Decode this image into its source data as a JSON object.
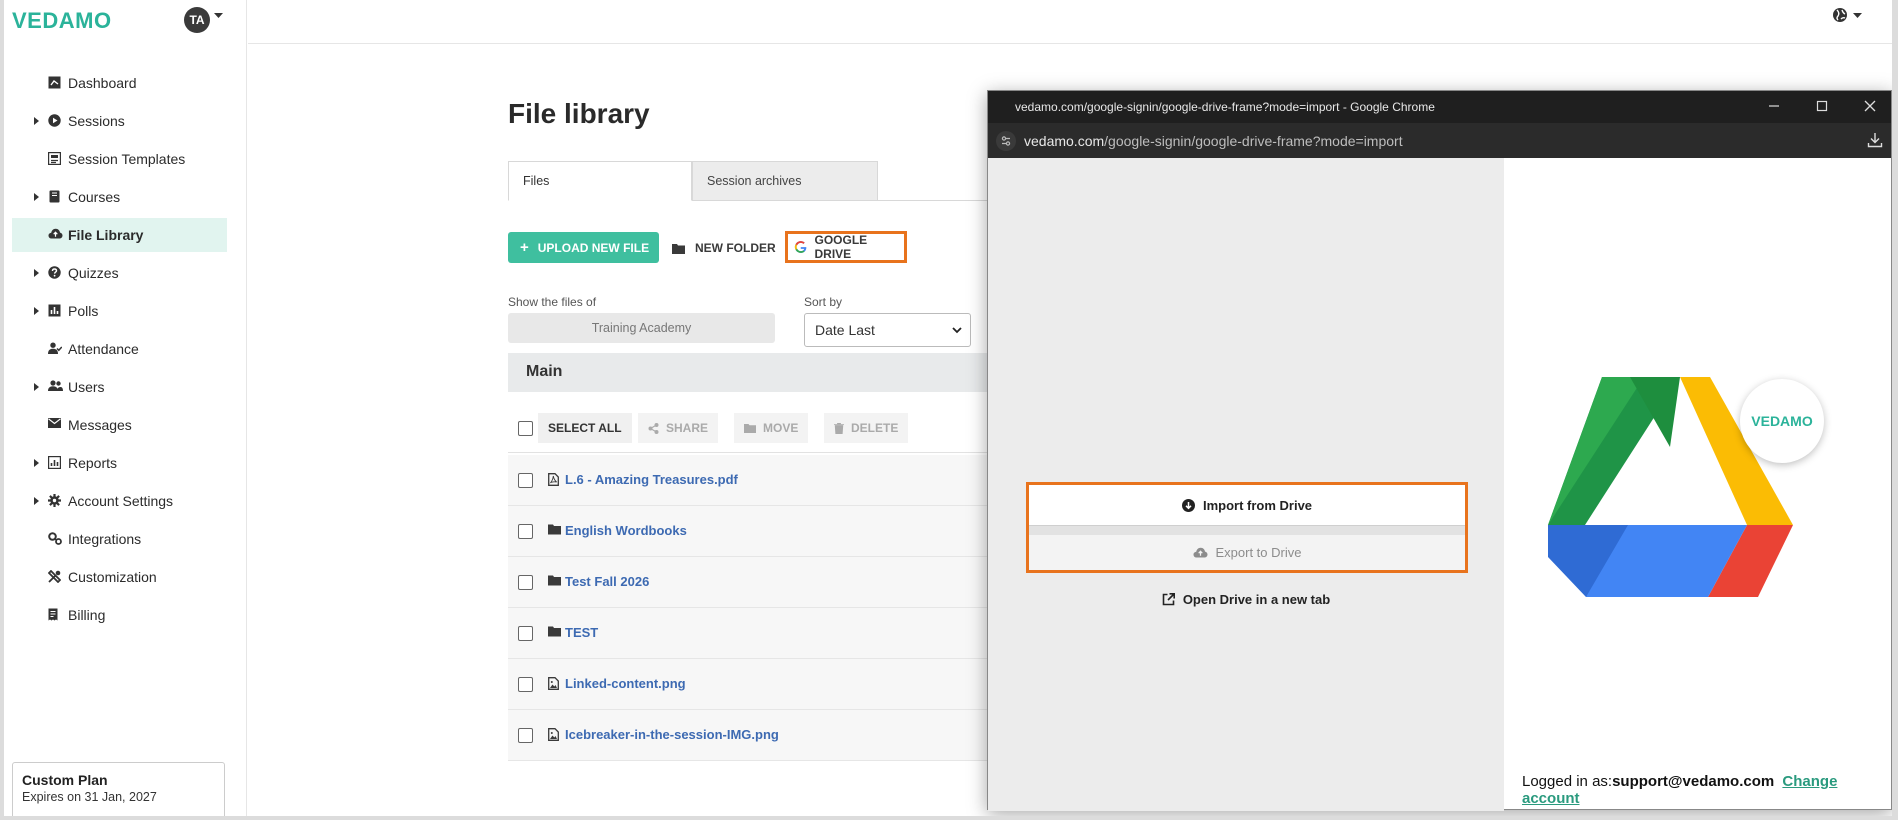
{
  "brand": {
    "logo": "VEDAMO",
    "accent": "#3fbf9f",
    "highlight": "#e8731d"
  },
  "user": {
    "initials": "TA"
  },
  "sidebar": {
    "items": [
      {
        "label": "Dashboard",
        "icon": "dashboard-icon",
        "expandable": false,
        "active": false
      },
      {
        "label": "Sessions",
        "icon": "play-circle-icon",
        "expandable": true,
        "active": false
      },
      {
        "label": "Session Templates",
        "icon": "template-icon",
        "expandable": false,
        "active": false
      },
      {
        "label": "Courses",
        "icon": "book-icon",
        "expandable": true,
        "active": false
      },
      {
        "label": "File Library",
        "icon": "cloud-icon",
        "expandable": false,
        "active": true
      },
      {
        "label": "Quizzes",
        "icon": "question-icon",
        "expandable": true,
        "active": false
      },
      {
        "label": "Polls",
        "icon": "poll-icon",
        "expandable": true,
        "active": false
      },
      {
        "label": "Attendance",
        "icon": "attendance-icon",
        "expandable": false,
        "active": false
      },
      {
        "label": "Users",
        "icon": "users-icon",
        "expandable": true,
        "active": false
      },
      {
        "label": "Messages",
        "icon": "envelope-icon",
        "expandable": false,
        "active": false
      },
      {
        "label": "Reports",
        "icon": "report-icon",
        "expandable": true,
        "active": false
      },
      {
        "label": "Account Settings",
        "icon": "gear-icon",
        "expandable": true,
        "active": false
      },
      {
        "label": "Integrations",
        "icon": "integrations-icon",
        "expandable": false,
        "active": false
      },
      {
        "label": "Customization",
        "icon": "tools-icon",
        "expandable": false,
        "active": false
      },
      {
        "label": "Billing",
        "icon": "billing-icon",
        "expandable": false,
        "active": false
      }
    ],
    "plan": {
      "title": "Custom Plan",
      "expires": "Expires on 31 Jan, 2027"
    }
  },
  "main": {
    "title": "File library",
    "tabs": [
      "Files",
      "Session archives"
    ],
    "buttons": {
      "upload": "UPLOAD NEW FILE",
      "new_folder": "NEW FOLDER",
      "google_drive": "GOOGLE DRIVE"
    },
    "filters": {
      "show_label": "Show the files of",
      "show_value": "Training Academy",
      "sort_label": "Sort by",
      "sort_value": "Date Last"
    },
    "folder_title": "Main",
    "actions": {
      "select_all": "SELECT ALL",
      "share": "SHARE",
      "move": "MOVE",
      "delete": "DELETE"
    },
    "files": [
      {
        "name": "L.6 - Amazing Treasures.pdf",
        "type": "pdf"
      },
      {
        "name": "English Wordbooks",
        "type": "folder"
      },
      {
        "name": "Test Fall 2026",
        "type": "folder"
      },
      {
        "name": "TEST",
        "type": "folder"
      },
      {
        "name": "Linked-content.png",
        "type": "image"
      },
      {
        "name": "Icebreaker-in-the-session-IMG.png",
        "type": "image"
      }
    ]
  },
  "popup": {
    "window_title": "vedamo.com/google-signin/google-drive-frame?mode=import - Google Chrome",
    "url_domain": "vedamo.com",
    "url_path": "/google-signin/google-drive-frame?mode=import",
    "import_label": "Import from Drive",
    "export_label": "Export to Drive",
    "open_tab_label": "Open Drive in a new tab",
    "badge": "VEDAMO",
    "logged_label": "Logged in as:",
    "logged_email": "support@vedamo.com",
    "change_account": "Change account"
  }
}
